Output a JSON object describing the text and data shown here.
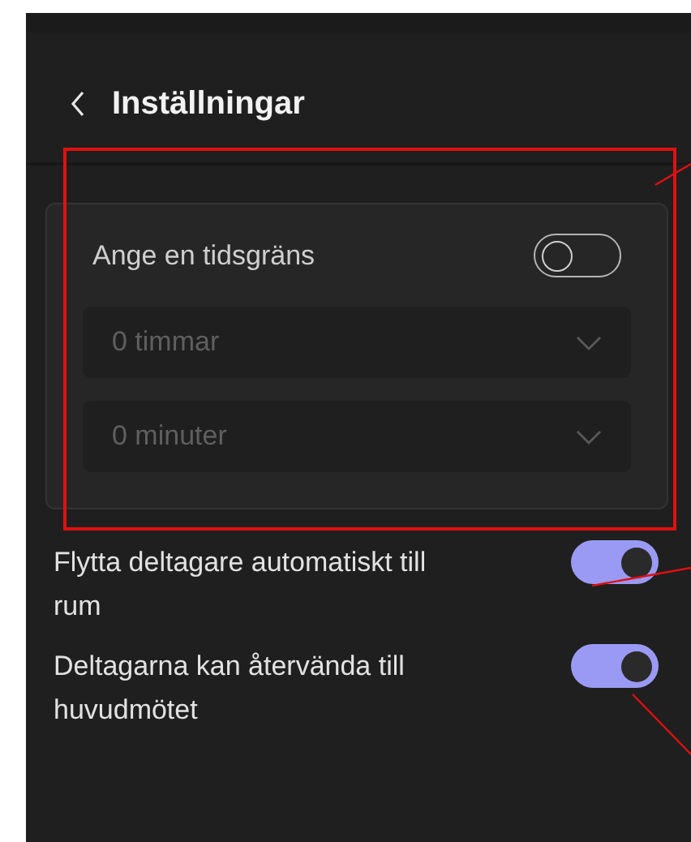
{
  "header": {
    "title": "Inställningar"
  },
  "time_limit": {
    "label": "Ange en tidsgräns",
    "on": false,
    "dropdowns": [
      {
        "value": "0 timmar",
        "disabled": true
      },
      {
        "value": "0 minuter",
        "disabled": true
      }
    ]
  },
  "options": [
    {
      "label": "Flytta deltagare automatiskt till rum",
      "on": true
    },
    {
      "label": "Deltagarna kan återvända till huvudmötet",
      "on": true
    }
  ]
}
